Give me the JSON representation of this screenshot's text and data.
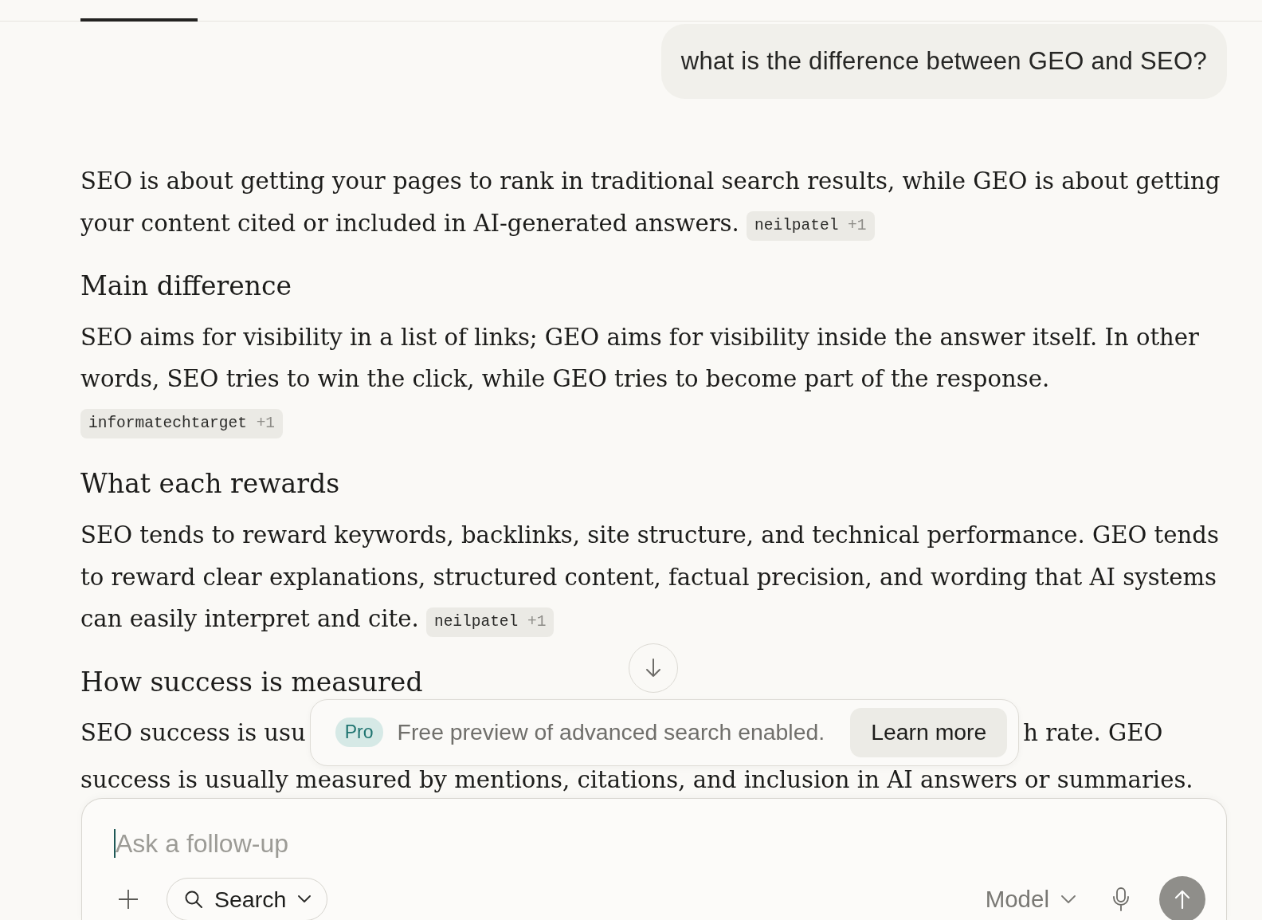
{
  "header": {
    "tabs": [
      {
        "selected": true
      }
    ]
  },
  "conversation": {
    "user_message": "what is the difference between GEO and SEO?",
    "answer": [
      {
        "kind": "paragraph",
        "text": "SEO is about getting your pages to rank in traditional search results, while GEO is about getting your content cited or included in AI-generated answers.",
        "citation": {
          "source": "neilpatel",
          "more": "+1"
        }
      },
      {
        "kind": "heading",
        "text": "Main difference"
      },
      {
        "kind": "paragraph",
        "text": "SEO aims for visibility in a list of links; GEO aims for visibility inside the answer itself. In other words, SEO tries to win the click, while GEO tries to become part of the response.",
        "citation": {
          "source": "informatechtarget",
          "more": "+1"
        }
      },
      {
        "kind": "heading",
        "text": "What each rewards"
      },
      {
        "kind": "paragraph",
        "text": "SEO tends to reward keywords, backlinks, site structure, and technical performance. GEO tends to reward clear explanations, structured content, factual precision, and wording that AI systems can easily interpret and cite.",
        "citation": {
          "source": "neilpatel",
          "more": "+1"
        }
      },
      {
        "kind": "heading",
        "text": "How success is measured"
      },
      {
        "kind": "covered_paragraph",
        "visible_parts": [
          "SEO success is usu",
          "h rate. GEO",
          "success is usually measured by mentions, citations, and inclusion in AI answers or summaries."
        ]
      }
    ]
  },
  "notice": {
    "badge": "Pro",
    "text": "Free preview of advanced search enabled.",
    "button": "Learn more"
  },
  "composer": {
    "placeholder": "Ask a follow-up",
    "search_button": "Search",
    "model_button": "Model"
  }
}
